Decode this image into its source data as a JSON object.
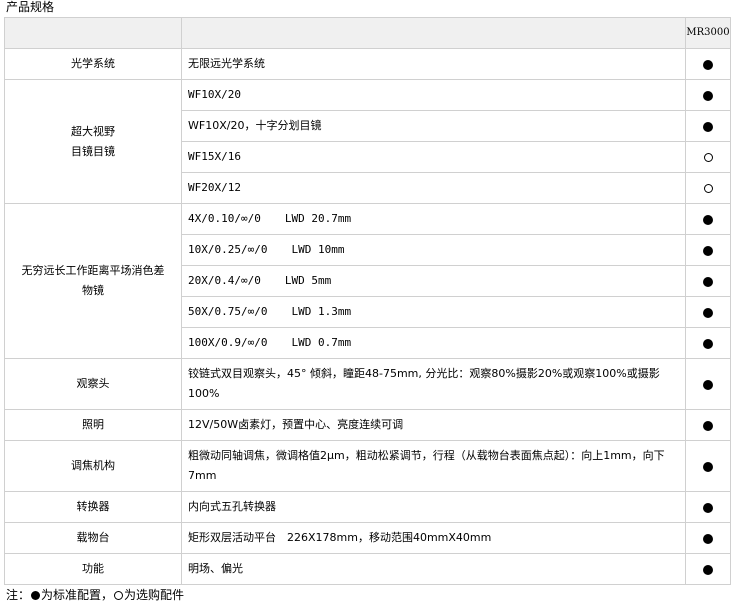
{
  "title": "产品规格",
  "header": {
    "model": "MR3000"
  },
  "rows": {
    "optical": {
      "category": "光学系统",
      "spec": "无限远光学系统",
      "mark": "std"
    },
    "eyepiece": {
      "category_line1": "超大视野",
      "category_line2": "目镜目镜",
      "items": [
        {
          "spec": "WF10X/20",
          "mark": "std"
        },
        {
          "spec": "WF10X/20，十字分划目镜",
          "mark": "std"
        },
        {
          "spec": "WF15X/16",
          "mark": "opt"
        },
        {
          "spec": "WF20X/12",
          "mark": "opt"
        }
      ]
    },
    "objective": {
      "category_line1": "无穷远长工作距离平场消色差",
      "category_line2": "物镜",
      "items": [
        {
          "spec": "4X/0.10/∞/0",
          "lwd": "LWD 20.7mm",
          "mark": "std"
        },
        {
          "spec": "10X/0.25/∞/0",
          "lwd": "LWD 10mm",
          "mark": "std"
        },
        {
          "spec": "20X/0.4/∞/0",
          "lwd": "LWD 5mm",
          "mark": "std"
        },
        {
          "spec": "50X/0.75/∞/0",
          "lwd": "LWD 1.3mm",
          "mark": "std"
        },
        {
          "spec": "100X/0.9/∞/0",
          "lwd": "LWD 0.7mm",
          "mark": "std"
        }
      ]
    },
    "head": {
      "category": "观察头",
      "spec": "铰链式双目观察头，45° 倾斜，瞳距48-75mm, 分光比：观察80%摄影20%或观察100%或摄影100%",
      "mark": "std"
    },
    "illumination": {
      "category": "照明",
      "spec": "12V/50W卤素灯，预置中心、亮度连续可调",
      "mark": "std"
    },
    "focus": {
      "category": "调焦机构",
      "spec": "粗微动同轴调焦，微调格值2μm，粗动松紧调节，行程（从载物台表面焦点起）：向上1mm，向下7mm",
      "mark": "std"
    },
    "nosepiece": {
      "category": "转换器",
      "spec": "内向式五孔转换器",
      "mark": "std"
    },
    "stage": {
      "category": "载物台",
      "spec": "矩形双层活动平台　226X178mm，移动范围40mmX40mm",
      "mark": "std"
    },
    "function": {
      "category": "功能",
      "spec": "明场、偏光",
      "mark": "std"
    }
  },
  "note": {
    "prefix": "注：",
    "std_text": "为标准配置，",
    "opt_text": "为选购配件"
  }
}
